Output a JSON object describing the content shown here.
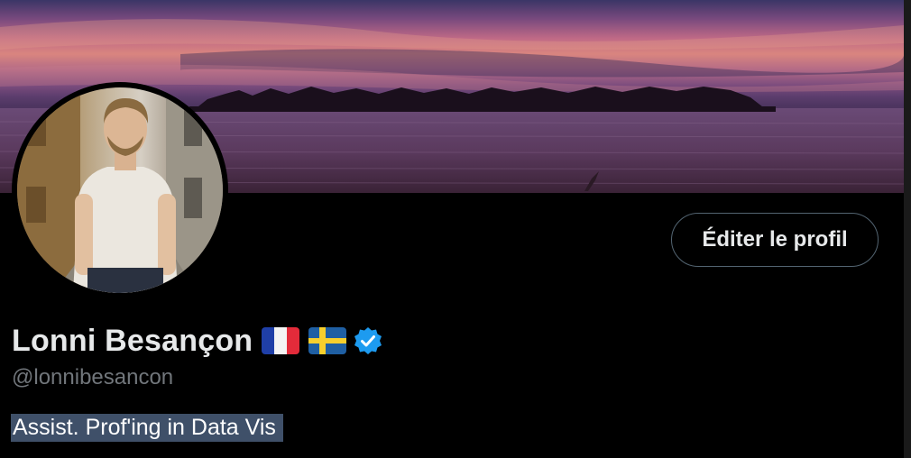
{
  "profile": {
    "display_name": "Lonni Besançon",
    "handle": "@lonnibesancon",
    "bio": "Assist. Prof'ing in Data Vis",
    "flags": [
      "france-flag",
      "sweden-flag"
    ],
    "verified": true
  },
  "actions": {
    "edit_profile_label": "Éditer le profil"
  },
  "colors": {
    "background": "#000000",
    "text_primary": "#e7e9ea",
    "text_secondary": "#71767b",
    "button_border": "#536471",
    "verified_blue": "#1d9bf0",
    "selection_highlight": "#3f5069"
  },
  "images": {
    "banner": "sunset-over-sea-with-island-banner",
    "avatar": "profile-photo-avatar"
  }
}
